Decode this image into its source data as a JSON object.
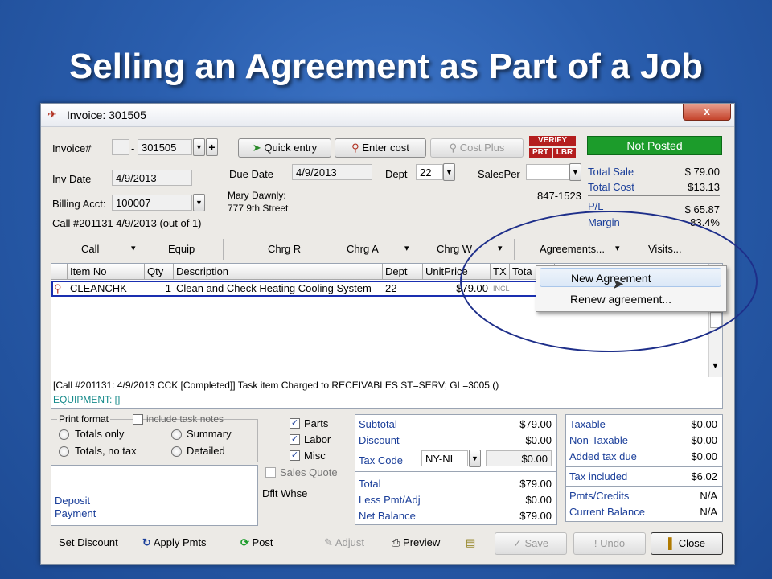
{
  "slide": {
    "title": "Selling an Agreement  as Part of a Job"
  },
  "window": {
    "title": "Invoice: 301505",
    "close_label": "x"
  },
  "header": {
    "invoice_label": "Invoice#",
    "invoice_prefix": "",
    "invoice_sep": "-",
    "invoice_number": "301505",
    "plus_label": "+",
    "quick_entry_label": "Quick entry",
    "enter_cost_label": "Enter cost",
    "cost_plus_label": "Cost Plus",
    "verify_label": "VERIFY",
    "prt_label": "PRT",
    "lbr_label": "LBR",
    "status_label": "Not Posted",
    "inv_date_label": "Inv Date",
    "inv_date": "4/9/2013",
    "due_date_label": "Due Date",
    "due_date": "4/9/2013",
    "dept_label": "Dept",
    "dept": "22",
    "salesper_label": "SalesPer",
    "salesper": "",
    "billing_label": "Billing Acct:",
    "billing_acct": "100007",
    "customer_name": "Mary Dawnly:",
    "customer_address": "777 9th Street",
    "phone": "847-1523",
    "call_info": "Call #201131 4/9/2013 (out of 1)"
  },
  "totals_top": {
    "total_sale_label": "Total Sale",
    "total_sale": "$ 79.00",
    "total_cost_label": "Total Cost",
    "total_cost": "$13.13",
    "pl_label": "P/L",
    "pl": "$ 65.87",
    "margin_label": "Margin",
    "margin": "83.4%"
  },
  "menubar": [
    {
      "label": "Call",
      "arrow": "▾"
    },
    {
      "label": "Equip"
    },
    {
      "label": "Chrg R"
    },
    {
      "label": "Chrg A",
      "arrow": "▾"
    },
    {
      "label": "Chrg W",
      "arrow": "▾"
    },
    {
      "label": "Agreements...",
      "arrow": "▾"
    },
    {
      "label": "Visits..."
    }
  ],
  "grid": {
    "columns": [
      "Item No",
      "Qty",
      "Description",
      "Dept",
      "UnitPrice",
      "TX",
      "Tota"
    ],
    "rows": [
      {
        "item_no": "CLEANCHK",
        "qty": "1",
        "description": "Clean and Check Heating Cooling System",
        "dept": "22",
        "unit_price": "$79.00",
        "tx": "INCL"
      }
    ]
  },
  "agreements_menu": [
    {
      "label": "New Agreement"
    },
    {
      "label": "Renew agreement..."
    }
  ],
  "status": {
    "line1": "[Call #201131: 4/9/2013 CCK [Completed]]   Task item Charged to RECEIVABLES ST=SERV; GL=3005 ()",
    "line2": "EQUIPMENT: []"
  },
  "print_format": {
    "label": "Print format",
    "include_task_notes": "include task notes",
    "totals_only": "Totals only",
    "summary": "Summary",
    "totals_no_tax": "Totals, no tax",
    "detailed": "Detailed"
  },
  "deposit": {
    "line1": "Deposit",
    "line2": "Payment"
  },
  "checks": {
    "parts": "Parts",
    "labor": "Labor",
    "misc": "Misc",
    "sales_quote": "Sales Quote",
    "dflt_whse": "Dflt Whse"
  },
  "summary": {
    "subtotal_label": "Subtotal",
    "subtotal": "$79.00",
    "discount_label": "Discount",
    "discount": "$0.00",
    "tax_code_label": "Tax Code",
    "tax_code": "NY-NI",
    "tax_amount": "$0.00",
    "total_label": "Total",
    "total": "$79.00",
    "less_pmt_label": "Less Pmt/Adj",
    "less_pmt": "$0.00",
    "net_balance_label": "Net Balance",
    "net_balance": "$79.00"
  },
  "tax_panel": {
    "taxable_label": "Taxable",
    "taxable": "$0.00",
    "non_taxable_label": "Non-Taxable",
    "non_taxable": "$0.00",
    "added_tax_label": "Added tax due",
    "added_tax": "$0.00",
    "tax_included_label": "Tax included",
    "tax_included": "$6.02",
    "pmts_label": "Pmts/Credits",
    "pmts": "N/A",
    "current_balance_label": "Current Balance",
    "current_balance": "N/A"
  },
  "footer": {
    "set_discount": "Set Discount",
    "apply_pmts": "Apply Pmts",
    "post": "Post",
    "adjust": "Adjust",
    "preview": "Preview",
    "save": "Save",
    "undo": "Undo",
    "close": "Close"
  }
}
